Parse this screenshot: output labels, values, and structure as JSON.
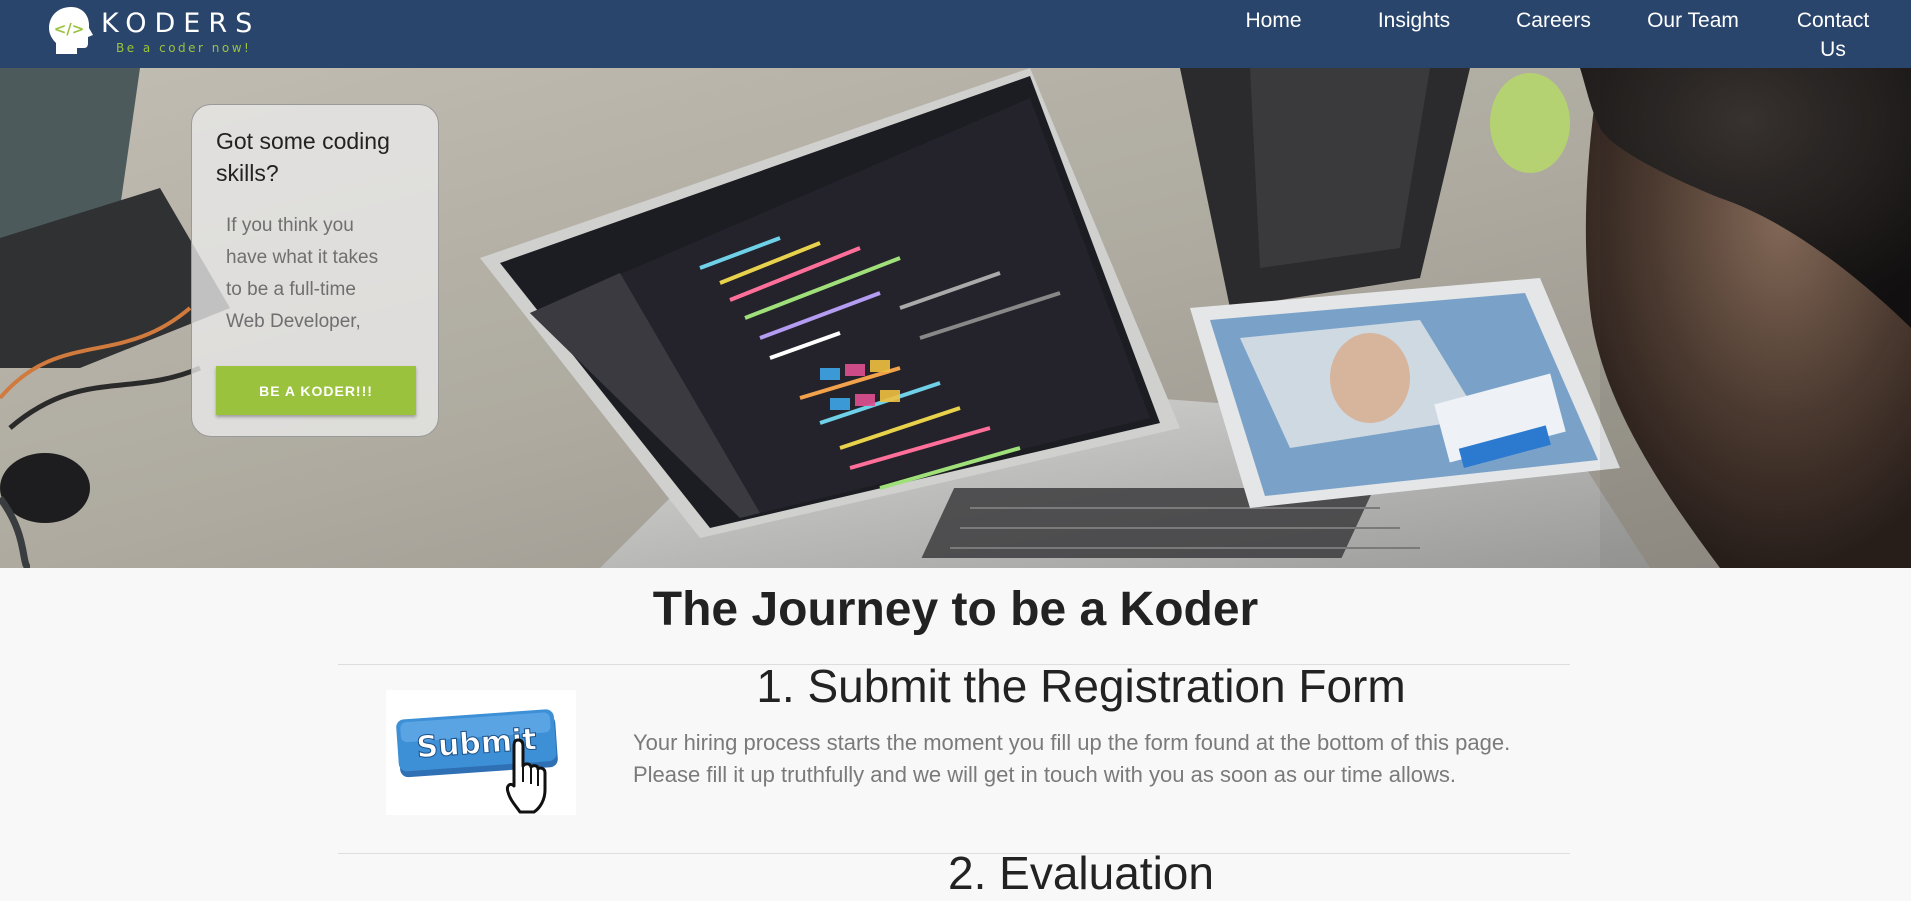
{
  "brand": {
    "name": "KODERS",
    "tagline": "Be a coder now!",
    "logo_icon": "code-head-icon"
  },
  "nav": {
    "items": [
      {
        "label": "Home"
      },
      {
        "label": "Insights"
      },
      {
        "label": "Careers"
      },
      {
        "label": "Our Team"
      },
      {
        "label": "Contact Us"
      }
    ]
  },
  "hero": {
    "image": "developer-laptop-photo",
    "promo": {
      "title": "Got some coding skills?",
      "text": "If you think you have what it takes to be a full-time Web Developer,",
      "button_label": "BE A KODER!!!"
    }
  },
  "journey": {
    "title": "The Journey to be a Koder",
    "steps": [
      {
        "title": "1. Submit the Registration Form",
        "image_label": "Submit",
        "description": "Your hiring process starts the moment you fill up the form found at the bottom of this page. Please fill it up truthfully and we will get in touch with you as soon as our time allows."
      },
      {
        "title": "2. Evaluation"
      }
    ]
  },
  "colors": {
    "navbar": "#2a456c",
    "accent": "#9ac23c",
    "background": "#f8f8f8",
    "submit_blue": "#3d8fd6"
  }
}
